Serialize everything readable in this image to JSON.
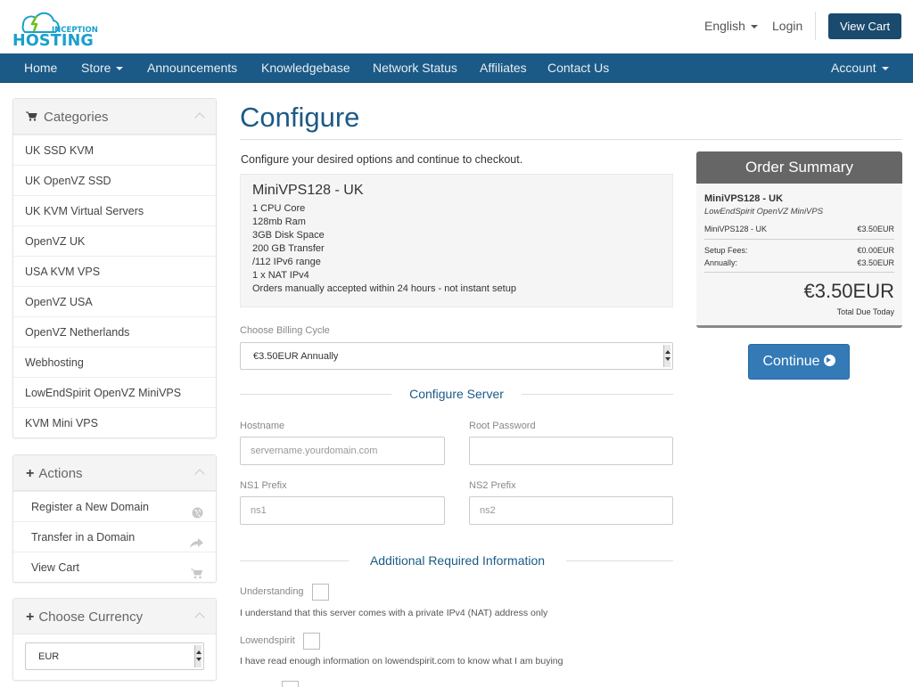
{
  "header": {
    "logo_top": "INCEPTION",
    "logo_main": "HOSTING",
    "language": "English",
    "login": "Login",
    "view_cart": "View Cart"
  },
  "nav": {
    "items": [
      "Home",
      "Store",
      "Announcements",
      "Knowledgebase",
      "Network Status",
      "Affiliates",
      "Contact Us"
    ],
    "account": "Account"
  },
  "sidebar": {
    "categories": {
      "title": "Categories",
      "items": [
        "UK SSD KVM",
        "UK OpenVZ SSD",
        "UK KVM Virtual Servers",
        "OpenVZ UK",
        "USA KVM VPS",
        "OpenVZ USA",
        "OpenVZ Netherlands",
        "Webhosting",
        "LowEndSpirit OpenVZ MiniVPS",
        "KVM Mini VPS"
      ]
    },
    "actions": {
      "title": "Actions",
      "items": [
        {
          "label": "Register a New Domain",
          "icon": "globe-icon"
        },
        {
          "label": "Transfer in a Domain",
          "icon": "share-icon"
        },
        {
          "label": "View Cart",
          "icon": "cart-icon"
        }
      ]
    },
    "currency": {
      "title": "Choose Currency",
      "selected": "EUR"
    }
  },
  "main": {
    "title": "Configure",
    "intro": "Configure your desired options and continue to checkout.",
    "product": {
      "name": "MiniVPS128 - UK",
      "features": [
        "1 CPU Core",
        "128mb Ram",
        "3GB Disk Space",
        "200 GB Transfer",
        "/112 IPv6 range",
        "1 x NAT IPv4",
        "Orders manually accepted within 24 hours - not instant setup"
      ]
    },
    "billing": {
      "label": "Choose Billing Cycle",
      "selected": "€3.50EUR Annually"
    },
    "configure_server": {
      "title": "Configure Server",
      "hostname_label": "Hostname",
      "hostname_placeholder": "servername.yourdomain.com",
      "root_password_label": "Root Password",
      "ns1_label": "NS1 Prefix",
      "ns1_placeholder": "ns1",
      "ns2_label": "NS2 Prefix",
      "ns2_placeholder": "ns2"
    },
    "additional": {
      "title": "Additional Required Information",
      "understanding_label": "Understanding",
      "understanding_help": "I understand that this server comes with a private IPv4 (NAT) address only",
      "lowendspirit_label": "Lowendspirit",
      "lowendspirit_help": "I have read enough information on lowendspirit.com to know what I am buying"
    }
  },
  "summary": {
    "title": "Order Summary",
    "product": "MiniVPS128 - UK",
    "group": "LowEndSpirit OpenVZ MiniVPS",
    "line_label": "MiniVPS128 - UK",
    "line_price": "€3.50EUR",
    "setup_label": "Setup Fees:",
    "setup_price": "€0.00EUR",
    "annually_label": "Annually:",
    "annually_price": "€3.50EUR",
    "total": "€3.50EUR",
    "total_label": "Total Due Today"
  },
  "continue_label": "Continue",
  "colors": {
    "brand": "#1b5a86",
    "nav_bg": "#1b5a86",
    "primary_button": "#337ab7",
    "view_cart_button": "#1a4a6e",
    "logo_green": "#6fbf1f"
  }
}
